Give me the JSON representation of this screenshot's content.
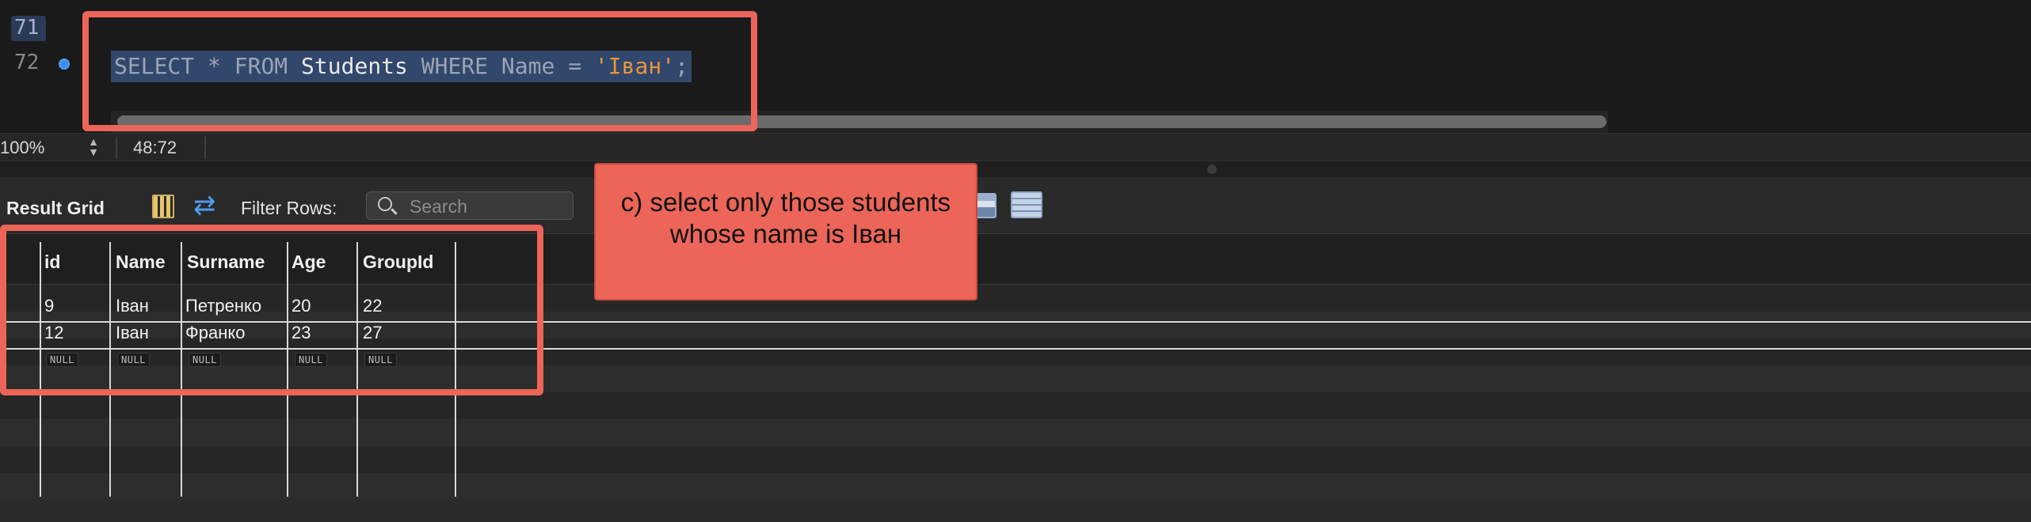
{
  "editor": {
    "line_numbers": [
      "71",
      "72"
    ],
    "tokens": [
      {
        "text": "SELECT",
        "kind": "kw"
      },
      {
        "text": " * ",
        "kind": "kw"
      },
      {
        "text": "FROM",
        "kind": "kw"
      },
      {
        "text": " Students ",
        "kind": "id"
      },
      {
        "text": "WHERE",
        "kind": "kw"
      },
      {
        "text": " Name = ",
        "kind": "kw"
      },
      {
        "text": "'Іван'",
        "kind": "str"
      },
      {
        "text": ";",
        "kind": "kw"
      }
    ]
  },
  "status": {
    "zoom": "100%",
    "cursor": "48:72"
  },
  "toolbar": {
    "title": "Result Grid",
    "filter_label": "Filter Rows:",
    "search_placeholder": "Search"
  },
  "grid": {
    "columns": [
      "id",
      "Name",
      "Surname",
      "Age",
      "GroupId"
    ],
    "rows": [
      [
        "9",
        "Іван",
        "Петренко",
        "20",
        "22"
      ],
      [
        "12",
        "Іван",
        "Франко",
        "23",
        "27"
      ]
    ],
    "null_label": "NULL"
  },
  "annotation": {
    "text": "c) select only those students whose name is Іван"
  },
  "colors": {
    "highlight": "#ec6558",
    "selection": "#31476c",
    "string": "#e8953a",
    "accent": "#4f9bf0"
  }
}
